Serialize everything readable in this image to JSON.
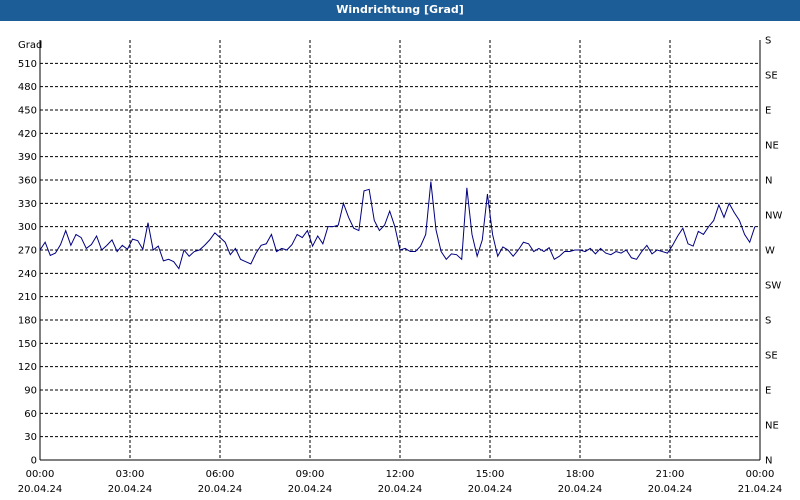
{
  "window": {
    "title": "Windrichtung [Grad]"
  },
  "chart_data": {
    "type": "line",
    "title": "Windrichtung [Grad]",
    "ylabel": "Grad",
    "ylim": [
      0,
      540
    ],
    "y_ticks": [
      0,
      30,
      60,
      90,
      120,
      150,
      180,
      210,
      240,
      270,
      300,
      330,
      360,
      390,
      420,
      450,
      480,
      510
    ],
    "right_axis_labels": [
      {
        "value": 0,
        "label": "N"
      },
      {
        "value": 45,
        "label": "NE"
      },
      {
        "value": 90,
        "label": "E"
      },
      {
        "value": 135,
        "label": "SE"
      },
      {
        "value": 180,
        "label": "S"
      },
      {
        "value": 225,
        "label": "SW"
      },
      {
        "value": 270,
        "label": "W"
      },
      {
        "value": 315,
        "label": "NW"
      },
      {
        "value": 360,
        "label": "N"
      },
      {
        "value": 405,
        "label": "NE"
      },
      {
        "value": 450,
        "label": "E"
      },
      {
        "value": 495,
        "label": "SE"
      },
      {
        "value": 540,
        "label": "S"
      }
    ],
    "x_range_hours": [
      0,
      24
    ],
    "x_ticks": [
      {
        "time": "00:00",
        "date": "20.04.24"
      },
      {
        "time": "03:00",
        "date": "20.04.24"
      },
      {
        "time": "06:00",
        "date": "20.04.24"
      },
      {
        "time": "09:00",
        "date": "20.04.24"
      },
      {
        "time": "12:00",
        "date": "20.04.24"
      },
      {
        "time": "15:00",
        "date": "20.04.24"
      },
      {
        "time": "18:00",
        "date": "20.04.24"
      },
      {
        "time": "21:00",
        "date": "20.04.24"
      },
      {
        "time": "00:00",
        "date": "21.04.24"
      }
    ],
    "grid": true,
    "series": [
      {
        "color": "#000080",
        "points": [
          [
            0.0,
            270
          ],
          [
            0.2,
            280
          ],
          [
            0.4,
            263
          ],
          [
            0.6,
            266
          ],
          [
            0.8,
            277
          ],
          [
            1.0,
            295
          ],
          [
            1.2,
            276
          ],
          [
            1.4,
            290
          ],
          [
            1.6,
            286
          ],
          [
            1.8,
            272
          ],
          [
            2.0,
            277
          ],
          [
            2.2,
            288
          ],
          [
            2.4,
            270
          ],
          [
            2.6,
            276
          ],
          [
            2.8,
            283
          ],
          [
            3.0,
            268
          ],
          [
            3.2,
            276
          ],
          [
            3.4,
            271
          ],
          [
            3.6,
            284
          ],
          [
            3.8,
            282
          ],
          [
            4.0,
            271
          ],
          [
            4.2,
            305
          ],
          [
            4.4,
            270
          ],
          [
            4.6,
            275
          ],
          [
            4.8,
            256
          ],
          [
            5.0,
            258
          ],
          [
            5.2,
            255
          ],
          [
            5.4,
            246
          ],
          [
            5.6,
            270
          ],
          [
            5.8,
            262
          ],
          [
            6.0,
            268
          ],
          [
            6.2,
            270
          ],
          [
            6.4,
            276
          ],
          [
            6.6,
            283
          ],
          [
            6.8,
            292
          ],
          [
            7.0,
            286
          ],
          [
            7.2,
            280
          ],
          [
            7.4,
            264
          ],
          [
            7.6,
            272
          ],
          [
            7.8,
            258
          ],
          [
            8.0,
            255
          ],
          [
            8.2,
            252
          ],
          [
            8.4,
            266
          ],
          [
            8.6,
            276
          ],
          [
            8.8,
            278
          ],
          [
            9.0,
            290
          ],
          [
            9.2,
            268
          ],
          [
            9.4,
            272
          ],
          [
            9.6,
            270
          ],
          [
            9.8,
            277
          ],
          [
            10.0,
            290
          ],
          [
            10.2,
            286
          ],
          [
            10.4,
            295
          ],
          [
            10.6,
            275
          ],
          [
            10.8,
            288
          ],
          [
            11.0,
            278
          ],
          [
            11.2,
            300
          ],
          [
            11.4,
            300
          ],
          [
            11.6,
            302
          ],
          [
            11.8,
            330
          ],
          [
            12.0,
            312
          ],
          [
            12.2,
            298
          ],
          [
            12.4,
            295
          ],
          [
            12.6,
            346
          ],
          [
            12.8,
            348
          ],
          [
            13.0,
            308
          ],
          [
            13.2,
            295
          ],
          [
            13.4,
            302
          ],
          [
            13.6,
            320
          ],
          [
            13.8,
            300
          ],
          [
            14.0,
            270
          ],
          [
            14.2,
            272
          ],
          [
            14.4,
            268
          ],
          [
            14.6,
            268
          ],
          [
            14.8,
            275
          ],
          [
            15.0,
            290
          ],
          [
            15.2,
            358
          ],
          [
            15.4,
            296
          ],
          [
            15.6,
            268
          ],
          [
            15.8,
            258
          ],
          [
            16.0,
            265
          ],
          [
            16.2,
            264
          ],
          [
            16.4,
            258
          ],
          [
            16.6,
            350
          ],
          [
            16.8,
            290
          ],
          [
            17.0,
            262
          ],
          [
            17.2,
            283
          ],
          [
            17.4,
            342
          ],
          [
            17.6,
            290
          ],
          [
            17.8,
            262
          ],
          [
            18.0,
            274
          ],
          [
            18.2,
            270
          ],
          [
            18.4,
            262
          ],
          [
            18.6,
            270
          ],
          [
            18.8,
            280
          ],
          [
            19.0,
            278
          ],
          [
            19.2,
            268
          ],
          [
            19.4,
            272
          ],
          [
            19.6,
            268
          ],
          [
            19.8,
            273
          ],
          [
            20.0,
            258
          ],
          [
            20.2,
            262
          ],
          [
            20.4,
            268
          ],
          [
            20.6,
            268
          ],
          [
            20.8,
            270
          ],
          [
            21.0,
            270
          ],
          [
            21.2,
            268
          ],
          [
            21.4,
            272
          ],
          [
            21.6,
            265
          ],
          [
            21.8,
            272
          ],
          [
            22.0,
            266
          ],
          [
            22.2,
            264
          ],
          [
            22.4,
            268
          ],
          [
            22.6,
            266
          ],
          [
            22.8,
            270
          ],
          [
            23.0,
            260
          ],
          [
            23.2,
            258
          ],
          [
            23.4,
            268
          ],
          [
            23.6,
            276
          ],
          [
            23.8,
            265
          ],
          [
            24.0,
            270
          ],
          [
            24.2,
            268
          ],
          [
            24.4,
            266
          ],
          [
            24.6,
            276
          ],
          [
            24.8,
            288
          ],
          [
            25.0,
            298
          ],
          [
            25.2,
            278
          ],
          [
            25.4,
            275
          ],
          [
            25.6,
            294
          ],
          [
            25.8,
            290
          ],
          [
            26.0,
            300
          ],
          [
            26.2,
            308
          ],
          [
            26.4,
            328
          ],
          [
            26.6,
            312
          ],
          [
            26.8,
            330
          ],
          [
            27.0,
            318
          ],
          [
            27.2,
            308
          ],
          [
            27.4,
            290
          ],
          [
            27.6,
            280
          ],
          [
            27.8,
            300
          ]
        ]
      }
    ]
  }
}
